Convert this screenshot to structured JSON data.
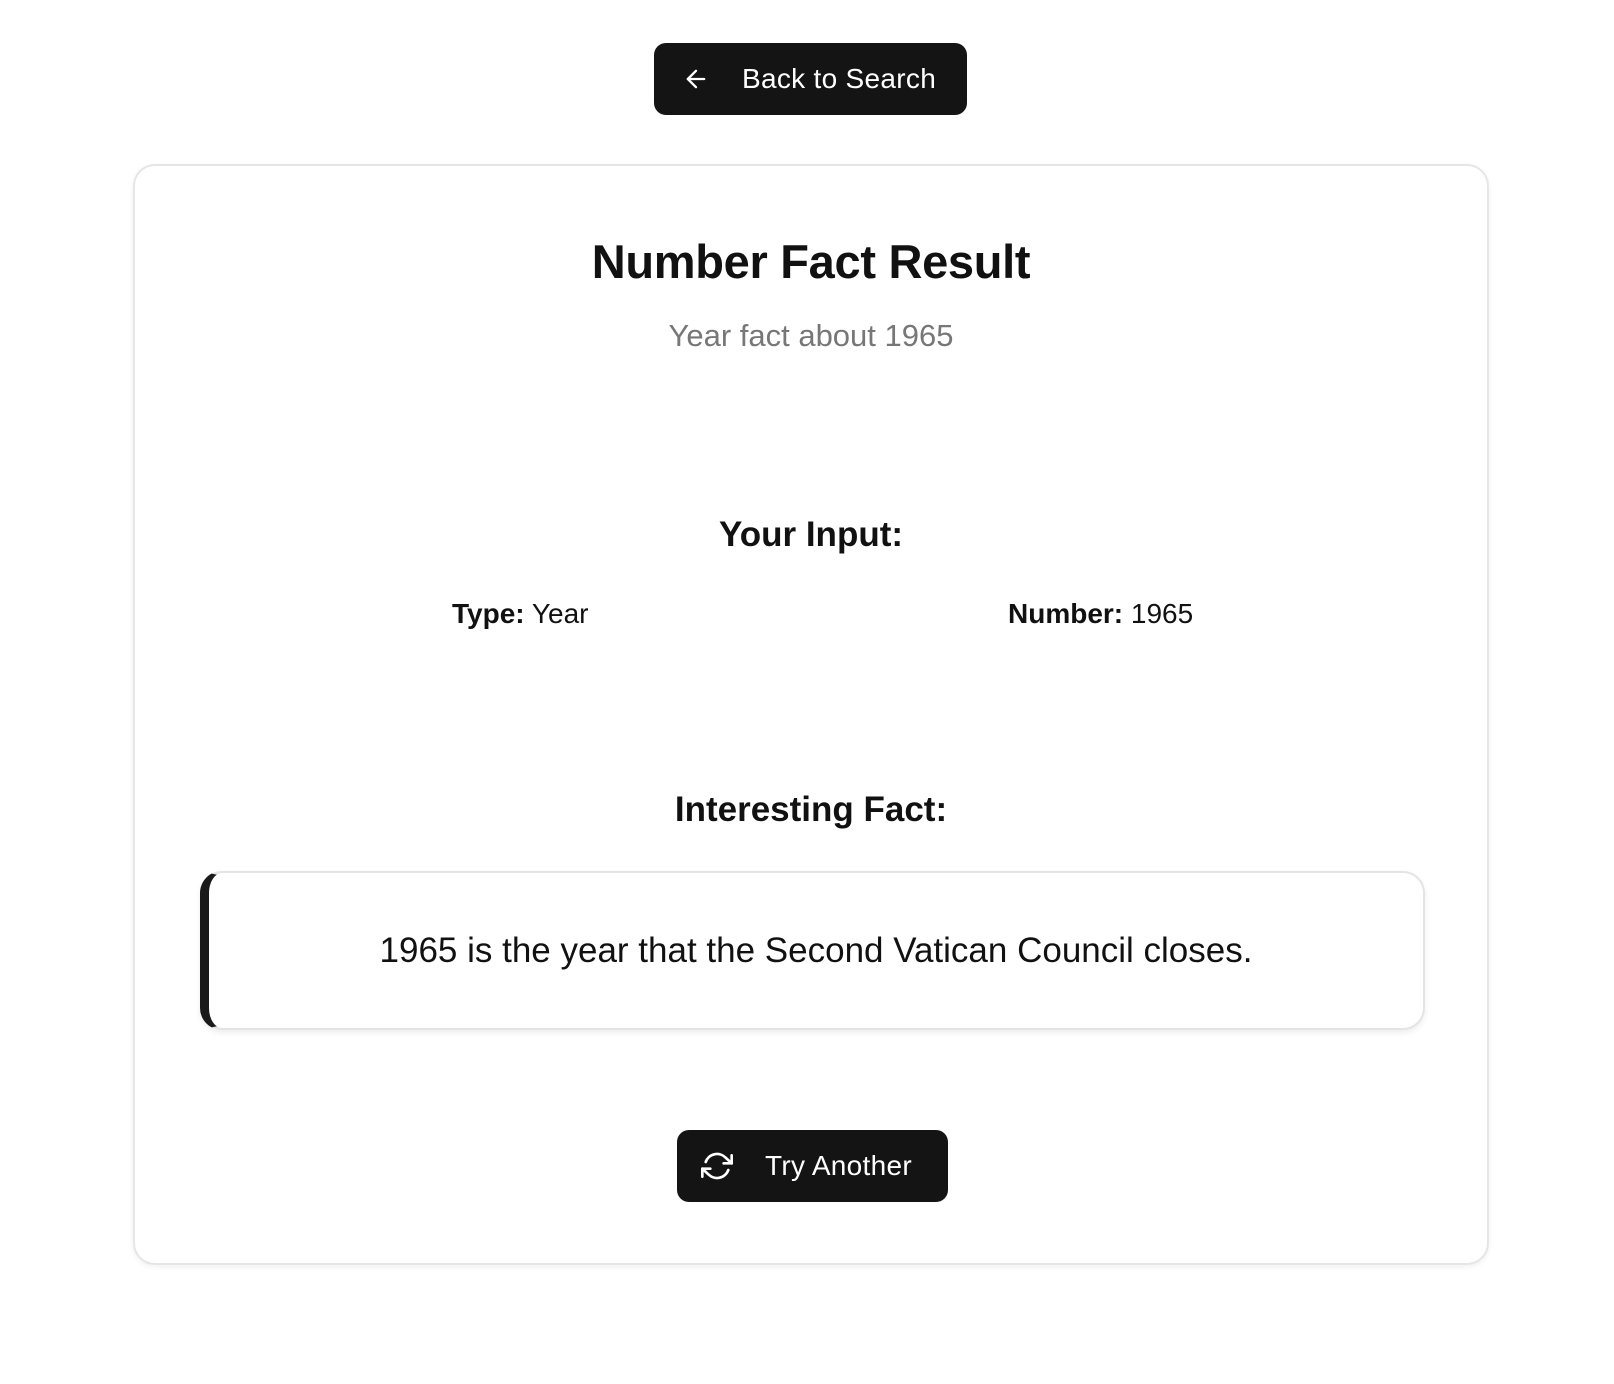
{
  "back_button": {
    "label": "Back to Search",
    "icon": "arrow-left-icon"
  },
  "card": {
    "title": "Number Fact Result",
    "subtitle": "Year fact about 1965",
    "input_section": {
      "heading": "Your Input:",
      "type_key": "Type:",
      "type_value": "Year",
      "number_key": "Number:",
      "number_value": "1965"
    },
    "fact_section": {
      "heading": "Interesting Fact:",
      "text": "1965 is the year that the Second Vatican Council closes."
    },
    "try_button": {
      "label": "Try Another",
      "icon": "refresh-icon"
    }
  },
  "colors": {
    "button_bg": "#141414",
    "button_text": "#ffffff",
    "subtitle": "#777777",
    "card_border": "#e6e6e6",
    "fact_accent": "#1a1a1a"
  }
}
